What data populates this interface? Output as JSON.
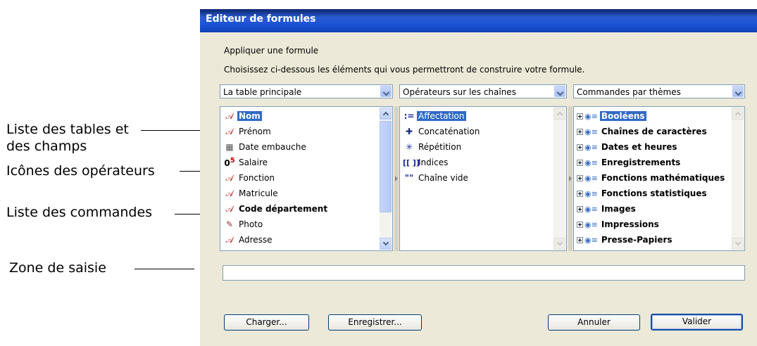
{
  "callouts": {
    "tables_line1": "Liste des tables et",
    "tables_line2": "des champs",
    "operators": "Icônes des opérateurs",
    "commands": "Liste des commandes",
    "input": "Zone de saisie"
  },
  "window": {
    "title": "Editeur de formules",
    "heading": "Appliquer une formule",
    "description": "Choisissez ci-dessous les éléments qui vous permettront de construire votre formule."
  },
  "combos": {
    "tables": "La table principale",
    "operators": "Opérateurs sur les chaînes",
    "commands": "Commandes par thèmes"
  },
  "fields": [
    {
      "label": "Nom",
      "icon": "text-field-icon",
      "selected": true,
      "bold": true
    },
    {
      "label": "Prénom",
      "icon": "text-field-icon"
    },
    {
      "label": "Date embauche",
      "icon": "date-field-icon"
    },
    {
      "label": "Salaire",
      "icon": "numeric-field-icon"
    },
    {
      "label": "Fonction",
      "icon": "text-field-icon"
    },
    {
      "label": "Matricule",
      "icon": "text-field-icon"
    },
    {
      "label": "Code département",
      "icon": "text-field-icon",
      "bold": true
    },
    {
      "label": "Photo",
      "icon": "picture-field-icon"
    },
    {
      "label": "Adresse",
      "icon": "text-field-icon"
    }
  ],
  "operators": [
    {
      "label": "Affectation",
      "icon": "assignment-icon",
      "glyph": ":=",
      "selected": true
    },
    {
      "label": "Concaténation",
      "icon": "plus-icon",
      "glyph": "✚"
    },
    {
      "label": "Répétition",
      "icon": "asterisk-icon",
      "glyph": "✳"
    },
    {
      "label": "Indices",
      "icon": "brackets-icon",
      "glyph": "[[ ]]"
    },
    {
      "label": "Chaîne vide",
      "icon": "empty-string-icon",
      "glyph": "\"\""
    }
  ],
  "commands": [
    {
      "label": "Booléens",
      "selected": true
    },
    {
      "label": "Chaînes de caractères"
    },
    {
      "label": "Dates et heures"
    },
    {
      "label": "Enregistrements"
    },
    {
      "label": "Fonctions mathématiques"
    },
    {
      "label": "Fonctions statistiques"
    },
    {
      "label": "Images"
    },
    {
      "label": "Impressions"
    },
    {
      "label": "Presse-Papiers"
    }
  ],
  "buttons": {
    "load": "Charger...",
    "save": "Enregistrer...",
    "cancel": "Annuler",
    "ok": "Valider"
  },
  "colors": {
    "selection": "#316ac5",
    "title_bar": "#1a52d6",
    "dialog_bg": "#ece9d8"
  }
}
